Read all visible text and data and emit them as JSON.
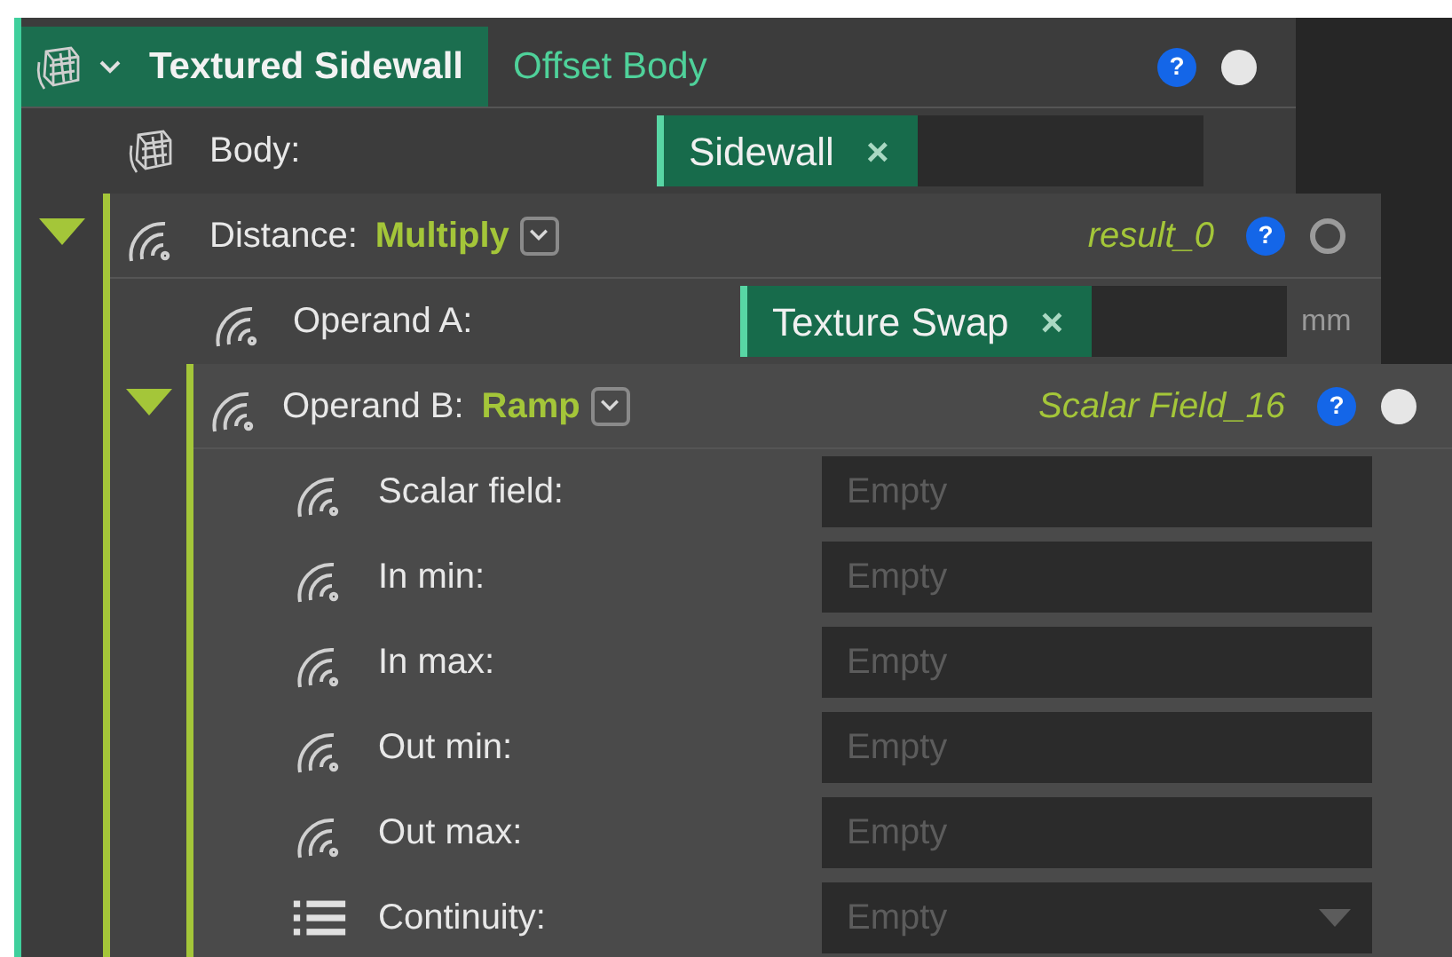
{
  "node": {
    "title": "Textured Sidewall",
    "type": "Offset Body",
    "expanded": true,
    "help": "?",
    "active": true,
    "rows": [
      {
        "kind": "object",
        "label": "Body:",
        "chip": "Sidewall",
        "remove": "×"
      },
      {
        "kind": "group",
        "label": "Distance:",
        "operation": "Multiply",
        "output": "result_0",
        "help": "?",
        "active": false,
        "expanded": true,
        "rows": [
          {
            "kind": "scalar",
            "label": "Operand A:",
            "chip": "Texture Swap",
            "remove": "×",
            "unit": "mm"
          },
          {
            "kind": "group",
            "label": "Operand B:",
            "operation": "Ramp",
            "output": "Scalar Field_16",
            "help": "?",
            "active": true,
            "expanded": true,
            "rows": [
              {
                "kind": "scalar",
                "label": "Scalar field:",
                "placeholder": "Empty"
              },
              {
                "kind": "scalar",
                "label": "In min:",
                "placeholder": "Empty"
              },
              {
                "kind": "scalar",
                "label": "In max:",
                "placeholder": "Empty"
              },
              {
                "kind": "scalar",
                "label": "Out min:",
                "placeholder": "Empty"
              },
              {
                "kind": "scalar",
                "label": "Out max:",
                "placeholder": "Empty"
              },
              {
                "kind": "choice",
                "label": "Continuity:",
                "placeholder": "Empty"
              }
            ]
          }
        ]
      }
    ]
  }
}
